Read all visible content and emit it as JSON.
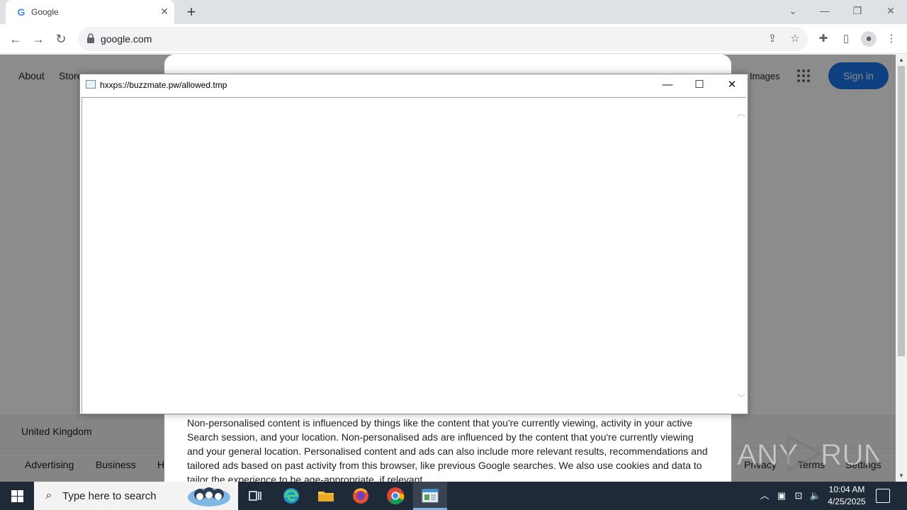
{
  "browser": {
    "tab_title": "Google",
    "favicon_letter": "G",
    "url": "google.com"
  },
  "google": {
    "about": "About",
    "store": "Store",
    "images": "Images",
    "sign_in": "Sign in",
    "country": "United Kingdom",
    "footer_left": [
      "Advertising",
      "Business",
      "H"
    ],
    "footer_right": [
      "Privacy",
      "Terms",
      "Settings"
    ],
    "consent_text": "Non-personalised content is influenced by things like the content that you're currently viewing, activity in your active Search session, and your location. Non-personalised ads are influenced by the content that you're currently viewing and your general location. Personalised content and ads can also include more relevant results, recommendations and tailored ads based on past activity from this browser, like previous Google searches. We also use cookies and data to tailor the experience to be age-appropriate, if relevant."
  },
  "popup": {
    "title": "hxxps://buzzmate.pw/allowed.tmp"
  },
  "taskbar": {
    "search_placeholder": "Type here to search",
    "time": "10:04 AM",
    "date": "4/25/2025"
  },
  "colors": {
    "accent": "#1a73e8",
    "taskbar": "#1f2a38"
  }
}
